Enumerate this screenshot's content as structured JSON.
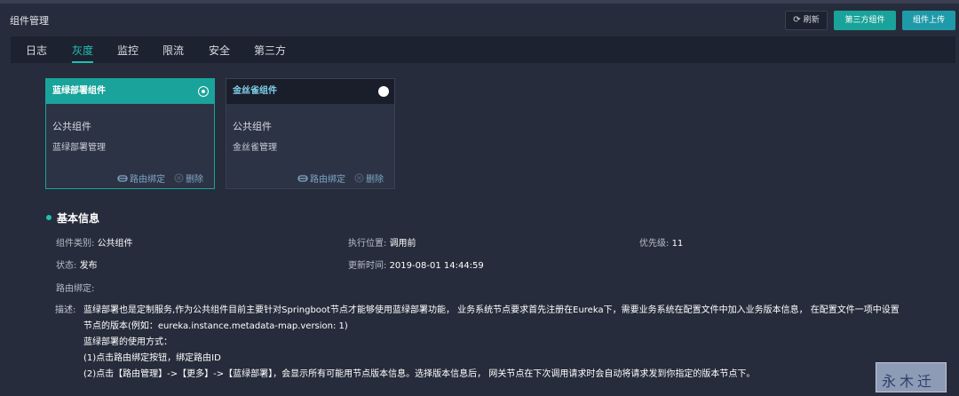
{
  "header": {
    "title": "组件管理",
    "refresh_label": "刷新",
    "third_party_label": "第三方组件",
    "upload_label": "组件上传"
  },
  "tabs": [
    {
      "label": "日志",
      "active": false
    },
    {
      "label": "灰度",
      "active": true
    },
    {
      "label": "监控",
      "active": false
    },
    {
      "label": "限流",
      "active": false
    },
    {
      "label": "安全",
      "active": false
    },
    {
      "label": "第三方",
      "active": false
    }
  ],
  "cards": [
    {
      "name": "蓝绿部署组件",
      "type": "公共组件",
      "desc": "蓝绿部署管理",
      "route_bind": "路由绑定",
      "delete": "删除",
      "selected": true
    },
    {
      "name": "金丝雀组件",
      "type": "公共组件",
      "desc": "金丝雀管理",
      "route_bind": "路由绑定",
      "delete": "删除",
      "selected": false
    }
  ],
  "basic_info": {
    "title": "基本信息",
    "category_label": "组件类别:",
    "category_value": "公共组件",
    "exec_pos_label": "执行位置:",
    "exec_pos_value": "调用前",
    "priority_label": "优先级:",
    "priority_value": "11",
    "status_label": "状态:",
    "status_value": "发布",
    "updated_label": "更新时间:",
    "updated_value": "2019-08-01 14:44:59",
    "route_bind_label": "路由绑定:",
    "desc_label": "描述:",
    "desc_lines": [
      "蓝绿部署也是定制服务,作为公共组件目前主要针对Springboot节点才能够使用蓝绿部署功能， 业务系统节点要求首先注册在Eureka下，需要业务系统在配置文件中加入业务版本信息， 在配置文件一项中设置",
      "节点的版本(例如：eureka.instance.metadata-map.version: 1)",
      "蓝绿部署的使用方式：",
      "(1)点击路由绑定按钮，绑定路由ID",
      "(2)点击【路由管理】->【更多】->【蓝绿部署】，会显示所有可能用节点版本信息。选择版本信息后， 网关节点在下次调用请求时会自动将请求发到你指定的版本节点下。"
    ]
  },
  "watermark": {
    "text": "永木迁华"
  },
  "colors": {
    "accent": "#1fc0b4",
    "primary_button": "#1aa39a",
    "background": "#262c3b"
  }
}
